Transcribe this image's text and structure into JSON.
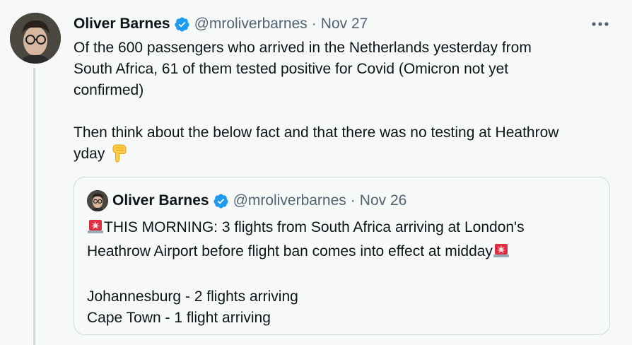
{
  "tweet": {
    "author_name": "Oliver Barnes",
    "handle": "@mroliverbarnes",
    "separator": "·",
    "date": "Nov 27",
    "more_label": "•••",
    "line1": "Of the 600 passengers who arrived in the Netherlands yesterday from",
    "line2": "South Africa, 61 of them tested positive for Covid (Omicron not yet",
    "line3": "confirmed)",
    "line4": "Then think about the below fact and that there was no testing at Heathrow",
    "line5": "yday"
  },
  "quoted_tweet": {
    "author_name": "Oliver Barnes",
    "handle": "@mroliverbarnes",
    "separator": "·",
    "date": "Nov 26",
    "line1": "THIS MORNING: 3 flights from South Africa arriving at London's",
    "line2": "Heathrow Airport before flight ban comes into effect at midday",
    "line3": "Johannesburg - 2 flights arriving",
    "line4": "Cape Town - 1 flight arriving"
  },
  "icons": {
    "verified": "verified-badge-icon",
    "more": "more-options-icon",
    "pointing_down": "backhand-index-pointing-down-emoji",
    "siren": "police-car-light-emoji"
  },
  "colors": {
    "background": "#f7f9f9",
    "text_primary": "#0f1419",
    "text_secondary": "#536471",
    "verified_blue": "#1d9bf0",
    "border": "#cfd9de"
  }
}
